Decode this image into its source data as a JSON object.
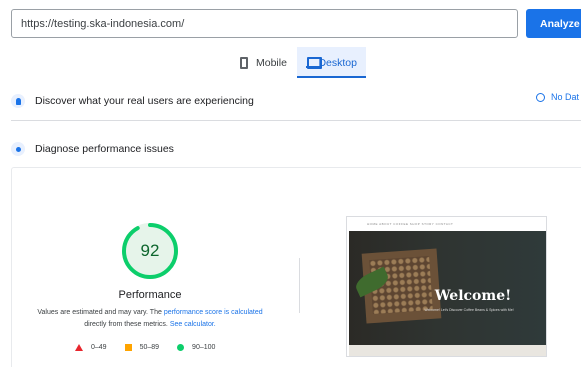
{
  "search": {
    "url": "https://testing.ska-indonesia.com/",
    "analyze_label": "Analyze"
  },
  "tabs": [
    {
      "label": "Mobile",
      "icon": "phone-icon",
      "active": false
    },
    {
      "label": "Desktop",
      "icon": "laptop-icon",
      "active": true
    }
  ],
  "field_data": {
    "heading": "Discover what your real users are experiencing",
    "status": "No Dat"
  },
  "diagnose": {
    "heading": "Diagnose performance issues"
  },
  "performance": {
    "score": "92",
    "title": "Performance",
    "note_prefix": "Values are estimated and may vary. The ",
    "note_link1": "performance score is calculated",
    "note_middle": " directly from these metrics. ",
    "note_link2": "See calculator.",
    "legend": [
      {
        "range": "0–49",
        "color": "#e8262d"
      },
      {
        "range": "50–89",
        "color": "#ffa400"
      },
      {
        "range": "90–100",
        "color": "#0cce6b"
      }
    ]
  },
  "screenshot": {
    "nav_text": "HOME  ABOUT  COFFEE  SHOP  STORY  CONTACT",
    "headline": "Welcome!",
    "subline": "Welcome! Let's Discover Coffee Beans & Spices with Me!"
  },
  "colors": {
    "accent": "#1a73e8",
    "good": "#0cce6b"
  }
}
